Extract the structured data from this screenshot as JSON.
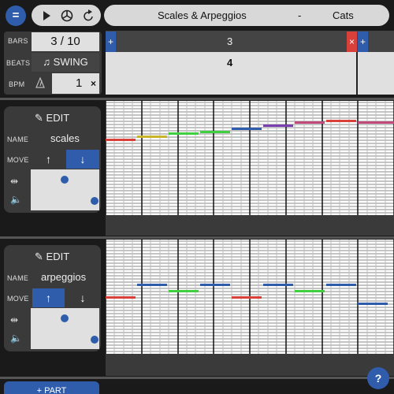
{
  "app": {
    "menu_icon": "menu-icon",
    "title": "Scales & Arpeggios",
    "separator": "-",
    "author": "Cats",
    "colors": {
      "accent": "#2f5dab",
      "red": "#d9403a",
      "dark": "#1a1a1a",
      "panel": "#3a3a3a",
      "light": "#e0e0e0"
    }
  },
  "transport": {
    "play": "play-icon",
    "metronome": "metronome-icon",
    "loop": "loop-icon"
  },
  "settings": {
    "bars_label": "BARS",
    "bars_value": "3 / 10",
    "beats_label": "BEATS",
    "swing_label": "♫ SWING",
    "bpm_label": "BPM",
    "bpm_value": "1",
    "bpm_clear": "×"
  },
  "timeline": {
    "add_left": "+",
    "bar_number": "3",
    "remove": "×",
    "add_right": "+",
    "beat_number": "4"
  },
  "parts": [
    {
      "edit_label": "EDIT",
      "name_label": "NAME",
      "name_value": "scales",
      "move_label": "MOVE",
      "move_up": "↑",
      "move_down": "↓",
      "active_move": "down",
      "slider_x": 0.78,
      "slider_y": 0.75
    },
    {
      "edit_label": "EDIT",
      "name_label": "NAME",
      "name_value": "arpeggios",
      "move_label": "MOVE",
      "move_up": "↑",
      "move_down": "↓",
      "active_move": "up",
      "slider_x": 0.78,
      "slider_y": 0.75
    }
  ],
  "add_part_label": "+ PART",
  "help_label": "?"
}
